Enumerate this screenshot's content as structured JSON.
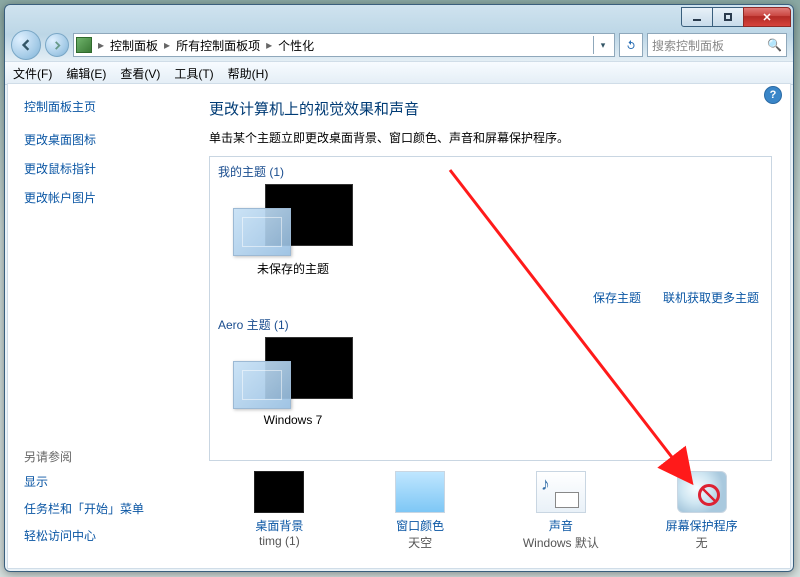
{
  "titlebar": {},
  "breadcrumb": {
    "item0": "控制面板",
    "item1": "所有控制面板项",
    "item2": "个性化"
  },
  "search": {
    "placeholder": "搜索控制面板"
  },
  "menu": {
    "file": "文件(F)",
    "edit": "编辑(E)",
    "view": "查看(V)",
    "tools": "工具(T)",
    "help": "帮助(H)"
  },
  "sidebar": {
    "home": "控制面板主页",
    "tasks": [
      "更改桌面图标",
      "更改鼠标指针",
      "更改帐户图片"
    ],
    "see_also_header": "另请参阅",
    "see_also": [
      "显示",
      "任务栏和「开始」菜单",
      "轻松访问中心"
    ]
  },
  "main": {
    "title": "更改计算机上的视觉效果和声音",
    "description": "单击某个主题立即更改桌面背景、窗口颜色、声音和屏幕保护程序。",
    "my_themes_header": "我的主题 (1)",
    "my_themes": [
      {
        "name": "未保存的主题"
      }
    ],
    "actions": {
      "save": "保存主题",
      "get_more": "联机获取更多主题"
    },
    "aero_header": "Aero 主题 (1)",
    "aero_themes": [
      {
        "name": "Windows 7"
      }
    ],
    "bottom": [
      {
        "label": "桌面背景",
        "sub": "timg (1)"
      },
      {
        "label": "窗口颜色",
        "sub": "天空"
      },
      {
        "label": "声音",
        "sub": "Windows 默认"
      },
      {
        "label": "屏幕保护程序",
        "sub": "无"
      }
    ]
  }
}
